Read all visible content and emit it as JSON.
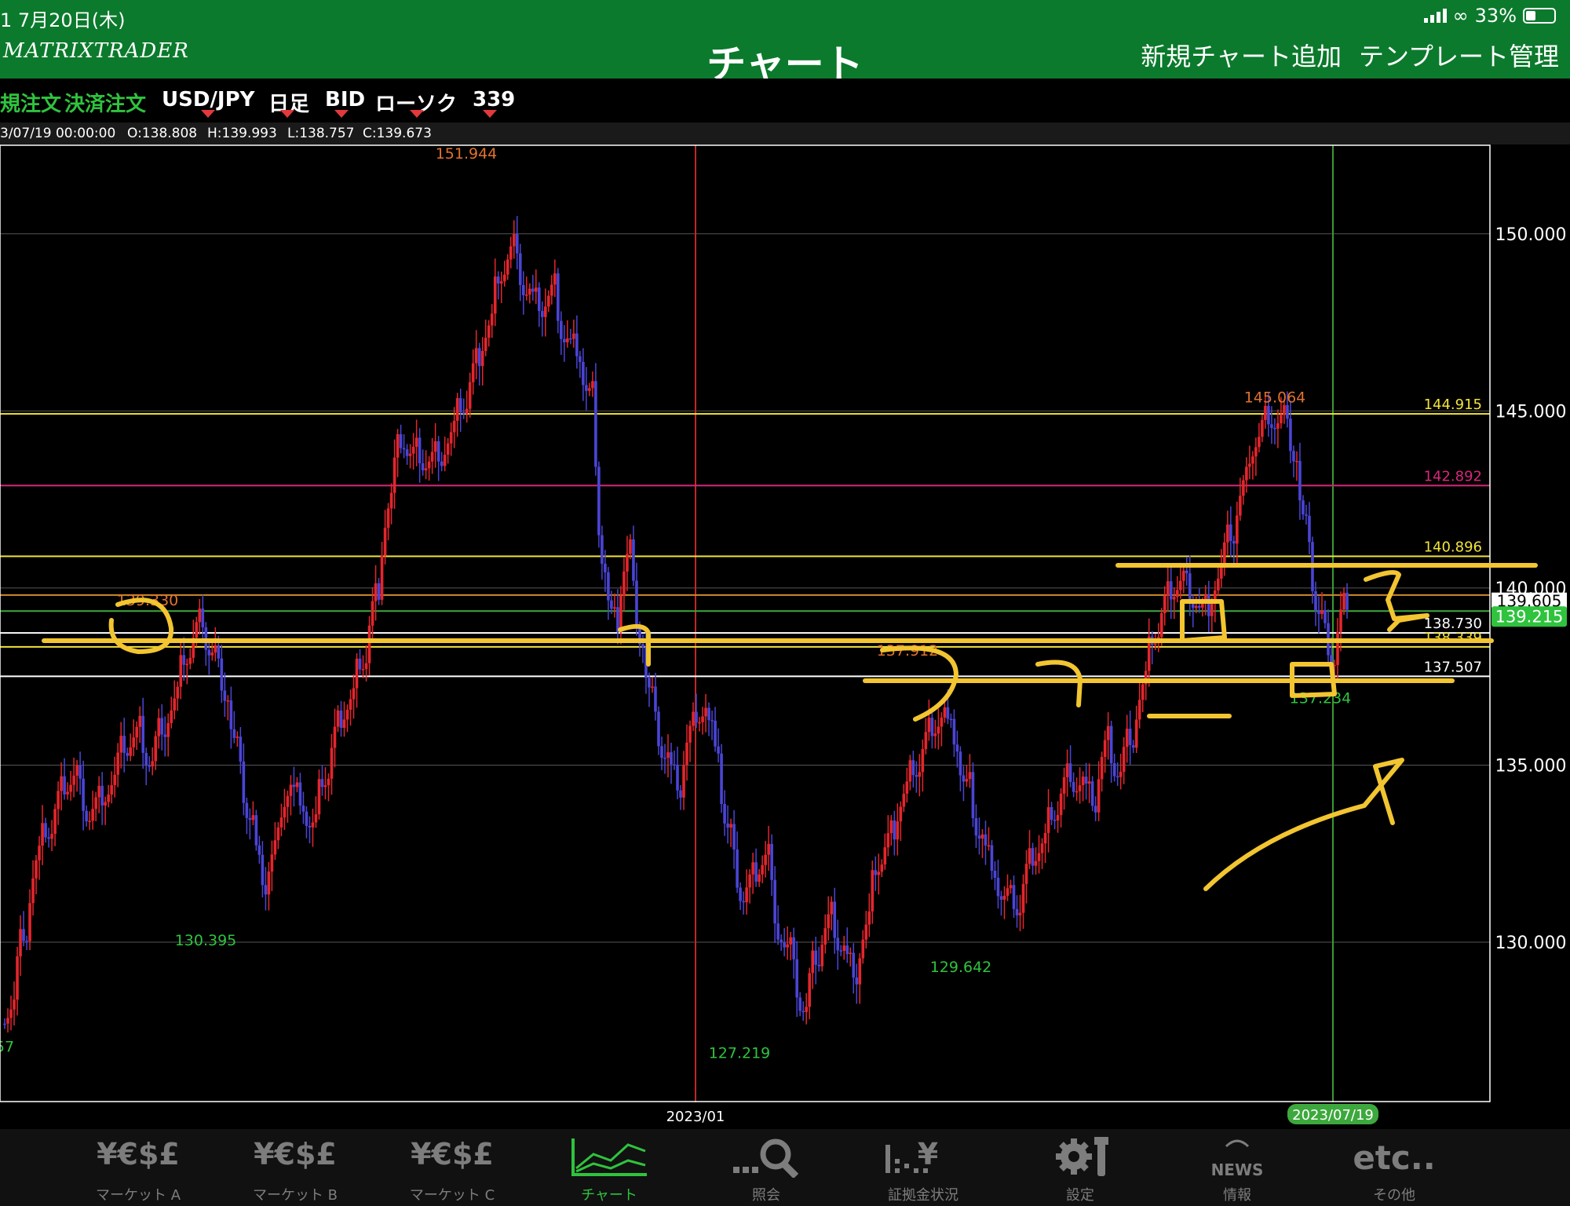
{
  "status": {
    "time": "1   7月20日(木)",
    "battery": "33%"
  },
  "nav": {
    "logo": "MATRIXTRADER",
    "title": "チャート",
    "add_chart": "新規チャート追加",
    "template": "テンプレート管理"
  },
  "toolbar": {
    "new_order": "規注文",
    "close_order": "決済注文",
    "pair": "USD/JPY",
    "period": "日足",
    "side": "BID",
    "chart_type": "ローソク",
    "count": "339"
  },
  "ohlc": {
    "date": "3/07/19 00:00:00",
    "open": "O:138.808",
    "high": "H:139.993",
    "low": "L:138.757",
    "close": "C:139.673"
  },
  "colors": {
    "bg": "#000000",
    "header": "#0b7a2c",
    "up": "#e4262c",
    "down": "#4a45d6",
    "drawing": "#f2c531",
    "accent_green": "#2fc33e",
    "high_label": "#e0722d"
  },
  "chart_data": {
    "type": "candlestick",
    "symbol": "USD/JPY",
    "timeframe": "日足",
    "ylim": [
      125.5,
      152.5
    ],
    "y_ticks": [
      "150.000",
      "145.000",
      "140.000",
      "135.000",
      "130.000"
    ],
    "x_labels": [
      "2023/01",
      "2023/07/19"
    ],
    "closes": [
      128.5,
      130.5,
      132.5,
      133.2,
      134.3,
      134.8,
      133.6,
      134.1,
      134.7,
      135.5,
      135.9,
      135.1,
      136.2,
      136.9,
      138.2,
      139.0,
      138.1,
      137.0,
      135.2,
      133.4,
      131.4,
      132.8,
      134.6,
      134.0,
      133.2,
      134.8,
      136.2,
      137.0,
      138.2,
      140.0,
      142.8,
      144.2,
      143.7,
      143.6,
      143.8,
      144.4,
      145.2,
      146.4,
      147.6,
      149.2,
      149.7,
      148.3,
      147.8,
      148.4,
      147.0,
      146.7,
      145.4,
      140.2,
      138.7,
      141.3,
      138.4,
      136.6,
      135.2,
      134.2,
      136.1,
      136.7,
      135.6,
      132.8,
      131.1,
      131.8,
      132.6,
      130.1,
      129.7,
      128.0,
      129.6,
      130.7,
      129.9,
      129.1,
      130.6,
      132.4,
      133.0,
      134.4,
      135.1,
      136.1,
      136.6,
      135.5,
      134.2,
      133.0,
      132.1,
      131.1,
      130.9,
      132.3,
      132.9,
      133.9,
      134.8,
      134.6,
      133.8,
      135.7,
      134.8,
      135.9,
      137.4,
      138.8,
      139.8,
      140.3,
      139.7,
      139.4,
      140.6,
      141.5,
      143.0,
      144.4,
      144.9,
      144.8,
      143.6,
      141.2,
      139.0,
      138.0,
      139.7
    ],
    "labels": [
      {
        "text": "151.944",
        "x": 151.944,
        "kind": "high"
      },
      {
        "text": "145.064",
        "x": 145.064,
        "kind": "high"
      },
      {
        "text": "139.330",
        "x": 139.33,
        "kind": "high"
      },
      {
        "text": "137.912",
        "x": 137.912,
        "kind": "high"
      },
      {
        "text": "130.395",
        "x": 130.395,
        "kind": "low"
      },
      {
        "text": "129.642",
        "x": 129.642,
        "kind": "low"
      },
      {
        "text": "127.219",
        "x": 127.219,
        "kind": "low"
      },
      {
        "text": "137.234",
        "x": 137.234,
        "kind": "low"
      },
      {
        "text": "57",
        "x": 127.4,
        "kind": "low"
      }
    ],
    "hlines": [
      {
        "value": 144.915,
        "label": "144.915",
        "color": "#f2e43a"
      },
      {
        "value": 142.892,
        "label": "142.892",
        "color": "#d6287a"
      },
      {
        "value": 140.896,
        "label": "140.896",
        "color": "#f2e43a"
      },
      {
        "value": 139.8,
        "label": "",
        "color": "#d08a2a"
      },
      {
        "value": 139.35,
        "label": "",
        "color": "#3da83d"
      },
      {
        "value": 138.73,
        "label": "138.730",
        "color": "#ffffff"
      },
      {
        "value": 138.339,
        "label": "138.339",
        "color": "#f2e43a"
      },
      {
        "value": 137.507,
        "label": "137.507",
        "color": "#ffffff"
      }
    ],
    "right_labels": {
      "ask": "139.605",
      "bid": "139.215"
    }
  },
  "tabs": [
    {
      "icon": "¥€$£",
      "label": "マーケット A"
    },
    {
      "icon": "¥€$£",
      "label": "マーケット B"
    },
    {
      "icon": "¥€$£",
      "label": "マーケット C"
    },
    {
      "icon": "",
      "label": "チャート"
    },
    {
      "icon": "",
      "label": "照会"
    },
    {
      "icon": "¥",
      "label": "証拠金状況"
    },
    {
      "icon": "",
      "label": "設定"
    },
    {
      "icon": "NEWS",
      "label": "情報"
    },
    {
      "icon": "etc..",
      "label": "その他"
    }
  ]
}
